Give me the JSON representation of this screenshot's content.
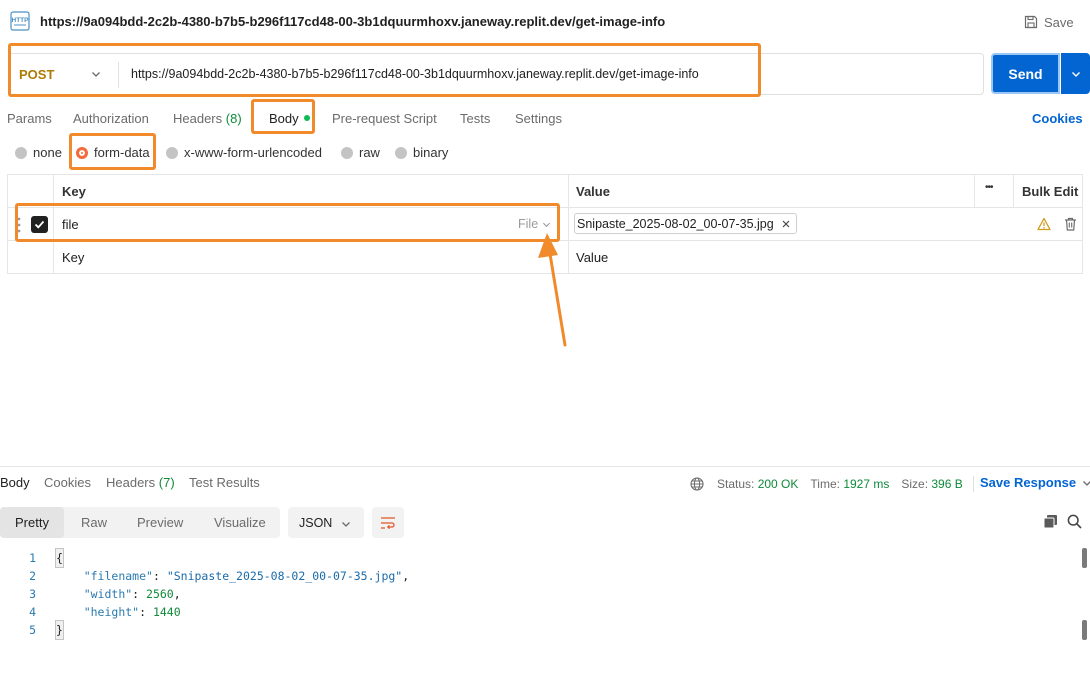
{
  "header": {
    "request_name": "https://9a094bdd-2c2b-4380-b7b5-b296f117cd48-00-3b1dquurmhoxv.janeway.replit.dev/get-image-info",
    "save_label": "Save",
    "icon": "http-icon"
  },
  "request": {
    "method": "POST",
    "url": "https://9a094bdd-2c2b-4380-b7b5-b296f117cd48-00-3b1dquurmhoxv.janeway.replit.dev/get-image-info",
    "send_label": "Send"
  },
  "tabs": {
    "params": "Params",
    "authorization": "Authorization",
    "headers": "Headers",
    "headers_count": "(8)",
    "body": "Body",
    "pre_request": "Pre-request Script",
    "tests": "Tests",
    "settings": "Settings",
    "cookies": "Cookies",
    "active": "Body"
  },
  "body_types": {
    "none": "none",
    "form_data": "form-data",
    "urlencoded": "x-www-form-urlencoded",
    "raw": "raw",
    "binary": "binary",
    "selected": "form-data"
  },
  "form_table": {
    "header_key": "Key",
    "header_value": "Value",
    "header_more": "•••",
    "header_bulk": "Bulk Edit",
    "row": {
      "checked": true,
      "key": "file",
      "type": "File",
      "value": "Snipaste_2025-08-02_00-07-35.jpg"
    },
    "placeholder_key": "Key",
    "placeholder_value": "Value"
  },
  "response": {
    "tabs": {
      "body": "Body",
      "cookies": "Cookies",
      "headers": "Headers",
      "headers_count": "(7)",
      "test_results": "Test Results"
    },
    "status_label": "Status:",
    "status_value": "200 OK",
    "time_label": "Time:",
    "time_value": "1927 ms",
    "size_label": "Size:",
    "size_value": "396 B",
    "save_response": "Save Response",
    "view_modes": {
      "pretty": "Pretty",
      "raw": "Raw",
      "preview": "Preview",
      "visualize": "Visualize"
    },
    "format": "JSON",
    "lines": [
      {
        "n": "1",
        "text": "{"
      },
      {
        "n": "2",
        "key": "\"filename\"",
        "value": "\"Snipaste_2025-08-02_00-07-35.jpg\"",
        "kind": "str",
        "trail": ","
      },
      {
        "n": "3",
        "key": "\"width\"",
        "value": "2560",
        "kind": "num",
        "trail": ","
      },
      {
        "n": "4",
        "key": "\"height\"",
        "value": "1440",
        "kind": "num",
        "trail": ""
      },
      {
        "n": "5",
        "text": "}"
      }
    ]
  },
  "colors": {
    "accent": "#0265d2",
    "method": "#ad7a03",
    "annotation": "#f08a2a",
    "status_ok": "#0f8a3a"
  }
}
